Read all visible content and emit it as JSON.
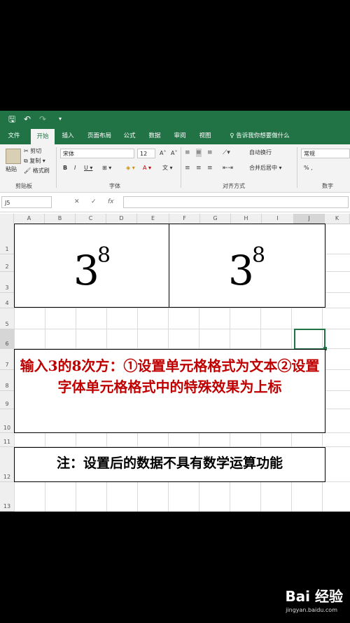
{
  "titlebar": {
    "save_icon": "🖫",
    "undo_icon": "↶",
    "redo_icon": "↷",
    "more_icon": "▾"
  },
  "tabs": [
    {
      "label": "文件"
    },
    {
      "label": "开始"
    },
    {
      "label": "插入"
    },
    {
      "label": "页面布局"
    },
    {
      "label": "公式"
    },
    {
      "label": "数据"
    },
    {
      "label": "审阅"
    },
    {
      "label": "视图"
    }
  ],
  "tell_me": "♀ 告诉我你想要做什么",
  "ribbon": {
    "clipboard": {
      "paste": "粘贴",
      "cut": "✂ 剪切",
      "copy": "⧉ 复制 ▾",
      "format_painter": "🖌 格式刷",
      "group": "剪贴板"
    },
    "font": {
      "family": "宋体",
      "size": "12",
      "grow": "A˄",
      "shrink": "A˅",
      "bold": "B",
      "italic": "I",
      "underline": "U ▾",
      "border": "⊞ ▾",
      "fill": "◈ ▾",
      "color": "A ▾",
      "wen": "文 ▾",
      "group": "字体"
    },
    "align": {
      "wrap": "自动换行",
      "merge": "合并后居中 ▾",
      "group": "对齐方式"
    },
    "number": {
      "format": "常规",
      "group": "数字",
      "percent": "% ,"
    }
  },
  "formula_bar": {
    "namebox": "J5",
    "cancel": "✕",
    "confirm": "✓",
    "fx": "fx"
  },
  "columns": [
    "A",
    "B",
    "C",
    "D",
    "E",
    "F",
    "G",
    "H",
    "I",
    "J",
    "K"
  ],
  "rows": [
    "1",
    "2",
    "3",
    "4",
    "5",
    "6",
    "7",
    "8",
    "9",
    "10",
    "11",
    "12",
    "13"
  ],
  "cells": {
    "left_base": "3",
    "left_exp": "8",
    "right_base": "3",
    "right_exp": "8",
    "instruction": "输入3的8次方：①设置单元格格式为文本②设置字体单元格格式中的特殊效果为上标",
    "note": "注：设置后的数据不具有数学运算功能"
  },
  "watermark": {
    "brand": "Bai 经验",
    "url": "jingyan.baidu.com"
  },
  "colors": {
    "excel_green": "#217346",
    "red_text": "#c00000"
  }
}
